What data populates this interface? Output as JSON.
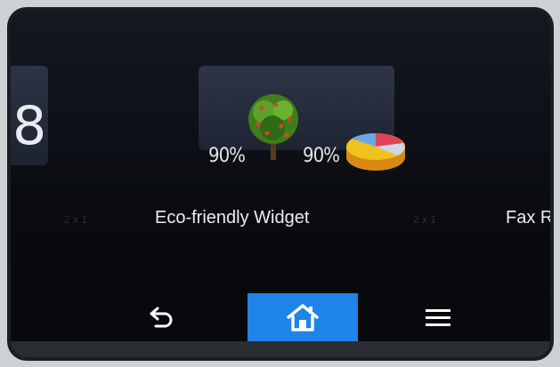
{
  "tiles": {
    "left_tile_number": "8",
    "eco_widget": {
      "percent_tree": "90%",
      "percent_pie": "90%",
      "tree_icon": "tree-icon",
      "pie_icon": "pie-chart-icon"
    }
  },
  "labels": {
    "size_left": "2 x 1",
    "eco_title": "Eco-friendly Widget",
    "size_right": "2 x 1",
    "fax_title": "Fax R"
  },
  "navbar": {
    "back_icon": "back-arrow-icon",
    "home_icon": "home-icon",
    "menu_icon": "menu-icon",
    "home_color": "#1e84e8"
  }
}
